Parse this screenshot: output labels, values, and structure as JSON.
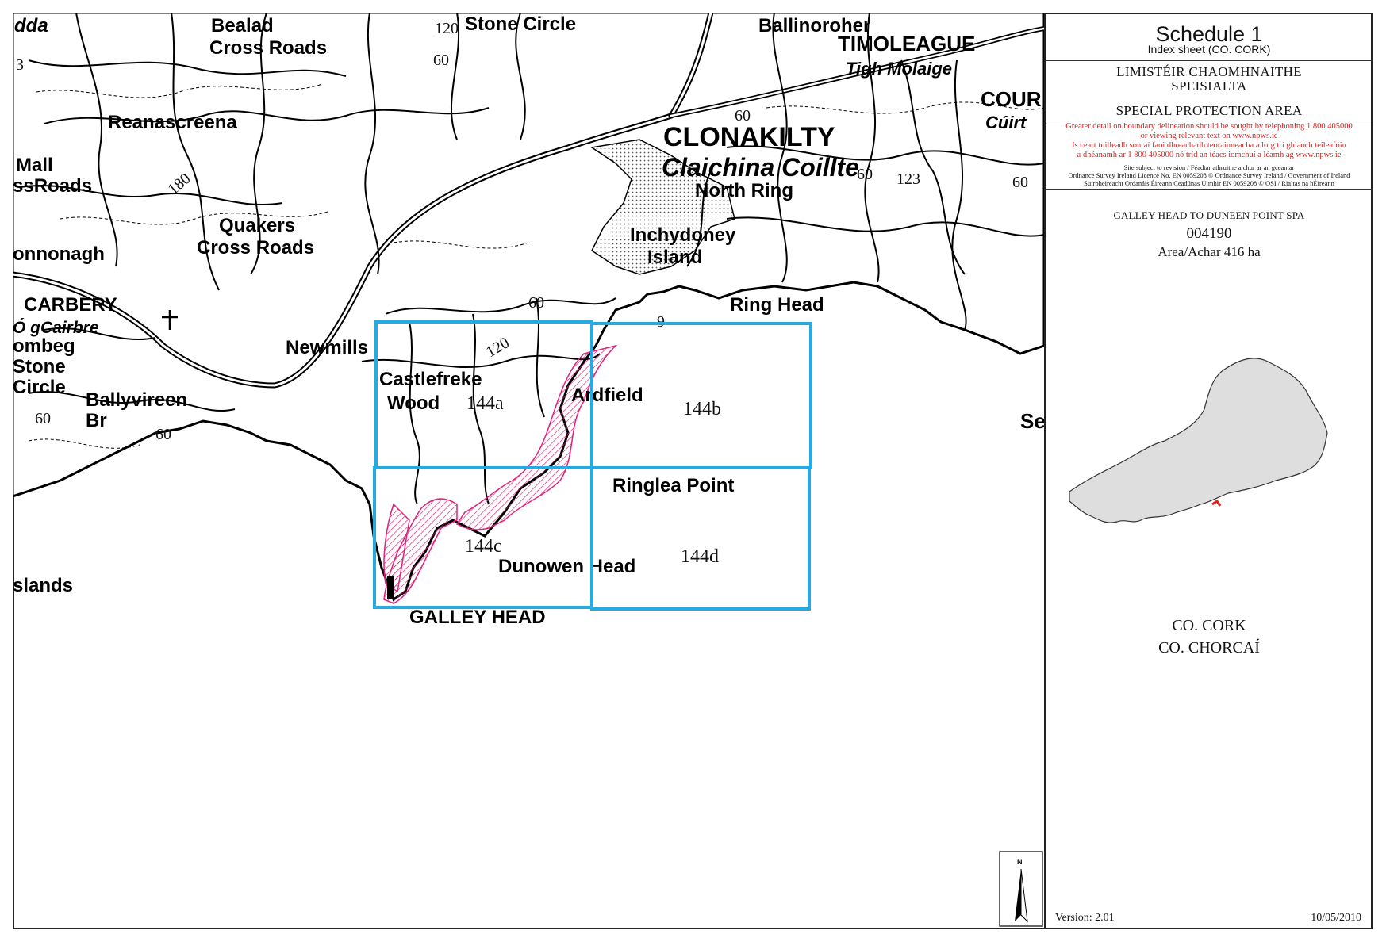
{
  "panel": {
    "schedule_title": "Schedule 1",
    "schedule_subtitle": "Index sheet (CO. CORK)",
    "irish_title_line1": "LIMISTÉIR CHAOMHNAITHE",
    "irish_title_line2": "SPEISIALTA",
    "english_title": "SPECIAL PROTECTION AREA",
    "red_note_1": "Greater detail on boundary delineation should be sought by telephoning 1 800 405000",
    "red_note_2": "or viewing relevant text on www.npws.ie",
    "red_note_3": "Is ceart tuilleadh sonraí faoi dhreachadh teorainneacha a lorg trí ghlaoch teileafóin",
    "red_note_4": "a dhéanamh ar 1 800 405000 nó tríd an téacs iomchuí a léamh ag www.npws.ie",
    "small_note_1": "Site subject to revision / Féadtar athruithe a chur ar an gceantar",
    "small_note_2": "Ordnance Survey Ireland Licence No. EN 0059208 © Ordnance Survey Ireland / Government of Ireland",
    "small_note_3": "Suirbhéireacht Ordanáis Éireann Ceadúnas Uimhir EN 0059208 © OSI / Rialtas na hÉireann",
    "site_name": "GALLEY HEAD TO DUNEEN POINT SPA",
    "site_code": "004190",
    "site_area": "Area/Achar 416 ha",
    "county_en": "CO. CORK",
    "county_ga": "CO. CHORCAÍ",
    "version": "Version: 2.01",
    "date": "10/05/2010"
  },
  "map": {
    "place_labels": {
      "bealad": "Bealad",
      "cross_roads_1": "Cross Roads",
      "stone_circle_top": "Stone Circle",
      "ballinoroher": "Ballinoroher",
      "timoleague": "TIMOLEAGUE",
      "tigh_molaige": "Tigh Molaige",
      "reanascreena": "Reanascreena",
      "clonakilty": "CLONAKILTY",
      "claichina_coillte": "Claichina Coillte",
      "courtmac": "COUR",
      "cuirt": "Cúirt",
      "mall": "Mall",
      "ss_roads": "ssRoads",
      "north_ring": "North Ring",
      "quakers": "Quakers",
      "cross_roads_2": "Cross Roads",
      "onnonagh": "onnonagh",
      "inchydoney": "Inchydoney",
      "island": "Island",
      "carbery": "CARBERY",
      "o_gcairbre": "Ó gCairbre",
      "ombeg": "ombeg",
      "stone": "Stone",
      "circle": "Circle",
      "ring_head": "Ring Head",
      "newmills": "Newmills",
      "castlefreke": "Castlefreke",
      "wood": "Wood",
      "ardfield": "Ardfield",
      "ballyvireen": "Ballyvireen",
      "br": "Br",
      "ringlea_point": "Ringlea Point",
      "dunowen_head": "Dunowen Head",
      "galley_head": "GALLEY HEAD",
      "slands": "slands",
      "se": "Se",
      "dda": "dda"
    },
    "spot_heights": [
      "120",
      "60",
      "180",
      "60",
      "123",
      "60",
      "60",
      "120",
      "60",
      "60",
      "60",
      "9",
      "3"
    ],
    "sheet_labels": {
      "a": "144a",
      "b": "144b",
      "c": "144c",
      "d": "144d"
    },
    "north_arrow_label": "N",
    "grid_color": "#27a9e1",
    "boundary_color": "#e0207a"
  }
}
